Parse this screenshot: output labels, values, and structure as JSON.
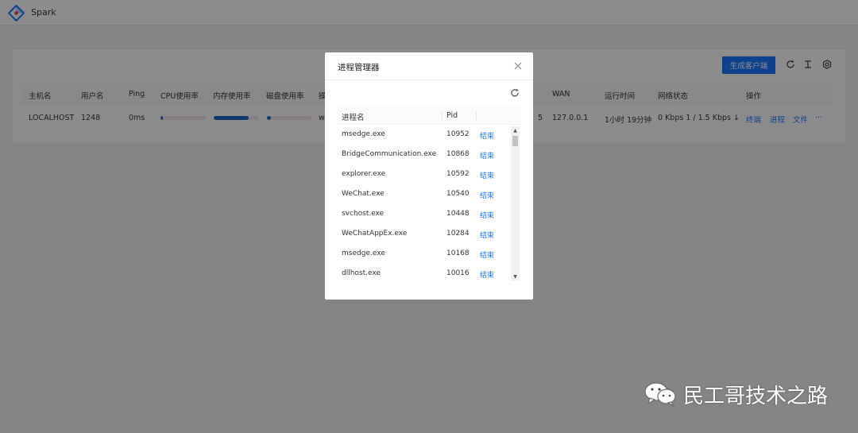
{
  "app": {
    "title": "Spark"
  },
  "toolbar": {
    "generate_client_label": "生成客户端",
    "reload_icon": "reload-icon",
    "terminal_icon": "text-cursor-icon",
    "settings_icon": "gear-icon"
  },
  "table": {
    "headers": {
      "hostname": "主机名",
      "username": "用户名",
      "ping": "Ping",
      "cpu": "CPU使用率",
      "memory": "内存使用率",
      "disk": "磁盘使用率",
      "os_partial": "操",
      "arch_partial": "",
      "wan": "WAN",
      "uptime": "运行时间",
      "network": "网络状态",
      "actions": "操作"
    },
    "row": {
      "hostname": "LOCALHOST",
      "username": "1248",
      "ping": "0ms",
      "cpu_percent": 5,
      "memory_percent": 78,
      "disk_percent": 8,
      "os_partial": "w",
      "col_partial": "5",
      "wan": "127.0.0.1",
      "uptime": "1小时 19分钟",
      "network": "0 Kbps 1 / 1.5 Kbps ↓",
      "action_terminal": "终端",
      "action_process": "进程",
      "action_file": "文件",
      "action_more": "···"
    }
  },
  "modal": {
    "title": "进程管理器",
    "close_icon": "close-icon",
    "reload_icon": "reload-icon",
    "col_name": "进程名",
    "col_pid": "Pid",
    "end_label": "结束",
    "processes": [
      {
        "name": "msedge.exe",
        "pid": "10952"
      },
      {
        "name": "BridgeCommunication.exe",
        "pid": "10868"
      },
      {
        "name": "explorer.exe",
        "pid": "10592"
      },
      {
        "name": "WeChat.exe",
        "pid": "10540"
      },
      {
        "name": "svchost.exe",
        "pid": "10448"
      },
      {
        "name": "WeChatAppEx.exe",
        "pid": "10284"
      },
      {
        "name": "msedge.exe",
        "pid": "10168"
      },
      {
        "name": "dllhost.exe",
        "pid": "10016"
      }
    ]
  },
  "watermark": {
    "text": "民工哥技术之路",
    "icon": "wechat-icon"
  },
  "colors": {
    "primary": "#1677ff",
    "bar_fill": "#1768c8",
    "bar_track": "#f5e6ee"
  }
}
